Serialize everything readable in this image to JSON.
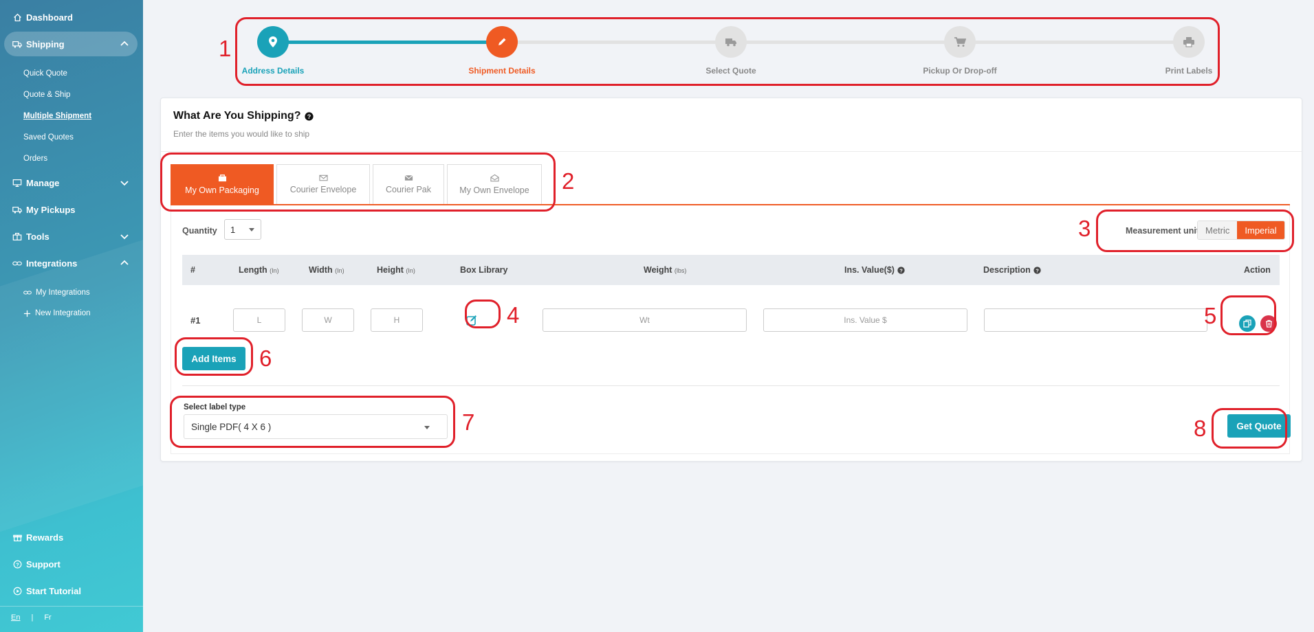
{
  "sidebar": {
    "dashboard": "Dashboard",
    "shipping": "Shipping",
    "shipping_sub": [
      "Quick Quote",
      "Quote & Ship",
      "Multiple Shipment",
      "Saved Quotes",
      "Orders"
    ],
    "manage": "Manage",
    "my_pickups": "My Pickups",
    "tools": "Tools",
    "integrations": "Integrations",
    "integrations_sub": [
      "My Integrations",
      "New Integration"
    ],
    "rewards": "Rewards",
    "support": "Support",
    "start_tutorial": "Start Tutorial",
    "lang_en": "En",
    "lang_sep": "|",
    "lang_fr": "Fr"
  },
  "stepper": {
    "steps": [
      "Address Details",
      "Shipment Details",
      "Select Quote",
      "Pickup Or Drop-off",
      "Print Labels"
    ]
  },
  "card": {
    "title": "What Are You Shipping?",
    "subtitle": "Enter the items you would like to ship"
  },
  "tabs": [
    "My Own Packaging",
    "Courier Envelope",
    "Courier Pak",
    "My Own Envelope"
  ],
  "quantity": {
    "label": "Quantity",
    "value": "1"
  },
  "measurement": {
    "label": "Measurement unit",
    "metric": "Metric",
    "imperial": "Imperial",
    "selected": "Imperial"
  },
  "table": {
    "headers": {
      "num": "#",
      "length": "Length",
      "length_unit": "(In)",
      "width": "Width",
      "width_unit": "(In)",
      "height": "Height",
      "height_unit": "(In)",
      "box_library": "Box Library",
      "weight": "Weight",
      "weight_unit": "(lbs)",
      "ins_value": "Ins. Value($)",
      "description": "Description",
      "action": "Action"
    },
    "row": {
      "num": "#1",
      "length_ph": "L",
      "width_ph": "W",
      "height_ph": "H",
      "weight_ph": "Wt",
      "ins_ph": "Ins. Value $",
      "description_ph": ""
    }
  },
  "add_items": "Add Items",
  "label_type": {
    "label": "Select label type",
    "value": "Single PDF( 4 X 6 )"
  },
  "get_quote": "Get Quote",
  "annotations": [
    "1",
    "2",
    "3",
    "4",
    "5",
    "6",
    "7",
    "8"
  ],
  "colors": {
    "teal": "#1aa2b8",
    "orange": "#ef5a23",
    "annotation_red": "#e0202a"
  }
}
